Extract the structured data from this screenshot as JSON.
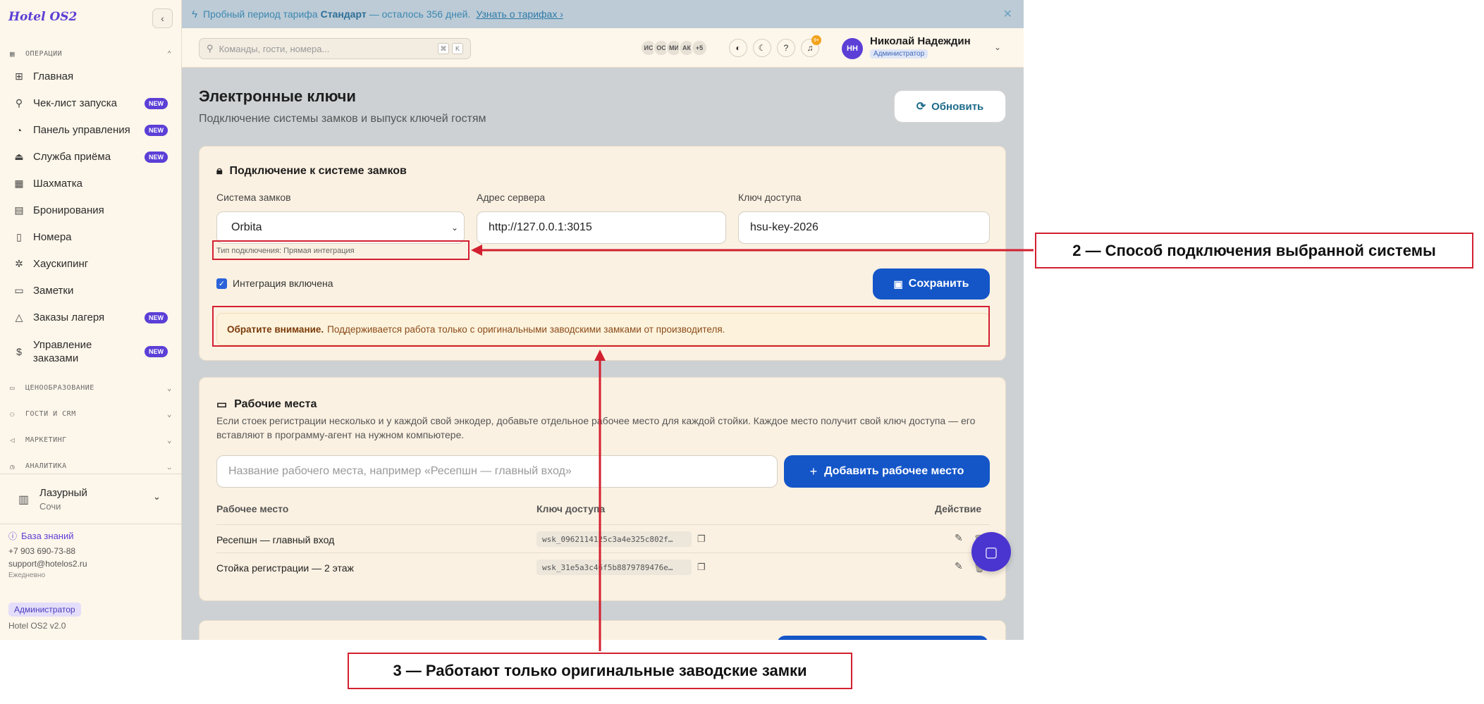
{
  "brand": "Hotel OS2",
  "sidebar": {
    "sections": [
      {
        "label": "ОПЕРАЦИИ",
        "icon": "grid-icon"
      },
      {
        "label": "ЦЕНООБРАЗОВАНИЕ",
        "icon": "tag-icon"
      },
      {
        "label": "ГОСТИ И CRM",
        "icon": "users-icon"
      },
      {
        "label": "МАРКЕТИНГ",
        "icon": "megaphone-icon"
      },
      {
        "label": "АНАЛИТИКА",
        "icon": "chart-icon"
      }
    ],
    "items": [
      {
        "label": "Главная",
        "icon": "dashboard-icon"
      },
      {
        "label": "Чек-лист запуска",
        "icon": "rocket-icon",
        "badge": "NEW"
      },
      {
        "label": "Панель управления",
        "icon": "gauge-icon",
        "badge": "NEW"
      },
      {
        "label": "Служба приёма",
        "icon": "bell-desk-icon",
        "badge": "NEW"
      },
      {
        "label": "Шахматка",
        "icon": "table-icon"
      },
      {
        "label": "Бронирования",
        "icon": "clipboard-icon"
      },
      {
        "label": "Номера",
        "icon": "door-icon"
      },
      {
        "label": "Хаускипинг",
        "icon": "sparkle-icon"
      },
      {
        "label": "Заметки",
        "icon": "note-icon"
      },
      {
        "label": "Заказы лагеря",
        "icon": "tent-icon",
        "badge": "NEW"
      },
      {
        "label": "Управление заказами",
        "icon": "dollar-icon",
        "badge": "NEW"
      }
    ],
    "hotel": {
      "name": "Лазурный",
      "city": "Сочи"
    },
    "knowledge_base": "База знаний",
    "phone": "+7 903 690-73-88",
    "email": "support@hotelos2.ru",
    "hours": "Ежедневно",
    "role": "Администратор",
    "version": "Hotel OS2 v2.0"
  },
  "banner": {
    "prefix": "Пробный период тарифа",
    "plan": "Стандарт",
    "suffix": "— осталось 356 дней.",
    "link": "Узнать о тарифах ›",
    "close": "✕"
  },
  "header": {
    "search_placeholder": "Команды, гости, номера...",
    "kbd1": "⌘",
    "kbd2": "K",
    "avatars": [
      "ИС",
      "ОС",
      "МИ",
      "АК",
      "+5"
    ],
    "bell_count": "9+",
    "user_initials": "НН",
    "user_name": "Николай Надеждин",
    "user_role": "Администратор"
  },
  "page": {
    "title": "Электронные ключи",
    "subtitle": "Подключение системы замков и выпуск ключей гостям",
    "refresh": "Обновить"
  },
  "lock_card": {
    "title": "Подключение к системе замков",
    "system_label": "Система замков",
    "system_value": "Orbita",
    "server_label": "Адрес сервера",
    "server_value": "http://127.0.0.1:3015",
    "key_label": "Ключ доступа",
    "key_value": "hsu-key-2026",
    "connection_type": "Тип подключения: Прямая интеграция",
    "integration_label": "Интеграция включена",
    "save": "Сохранить",
    "notice_bold": "Обратите внимание.",
    "notice_text": "Поддерживается работа только с оригинальными заводскими замками от производителя."
  },
  "workplaces": {
    "title": "Рабочие места",
    "description": "Если стоек регистрации несколько и у каждой свой энкодер, добавьте отдельное рабочее место для каждой стойки. Каждое место получит свой ключ доступа — его вставляют в программу-агент на нужном компьютере.",
    "input_placeholder": "Название рабочего места, например «Ресепшн — главный вход»",
    "add_button": "Добавить рабочее место",
    "columns": [
      "Рабочее место",
      "Ключ доступа",
      "Действие"
    ],
    "rows": [
      {
        "name": "Ресепшн — главный вход",
        "key": "wsk_0962114125c3a4e325c802f…"
      },
      {
        "name": "Стойка регистрации — 2 этаж",
        "key": "wsk_31e5a3c46f5b8879789476e…"
      }
    ]
  },
  "annotations": {
    "a2": "2 — Способ подключения выбранной системы",
    "a3": "3 — Работают только оригинальные заводские замки"
  },
  "colors": {
    "accent": "#5b3fd6",
    "primary_button": "#1456c8",
    "annotation": "#d22030"
  }
}
